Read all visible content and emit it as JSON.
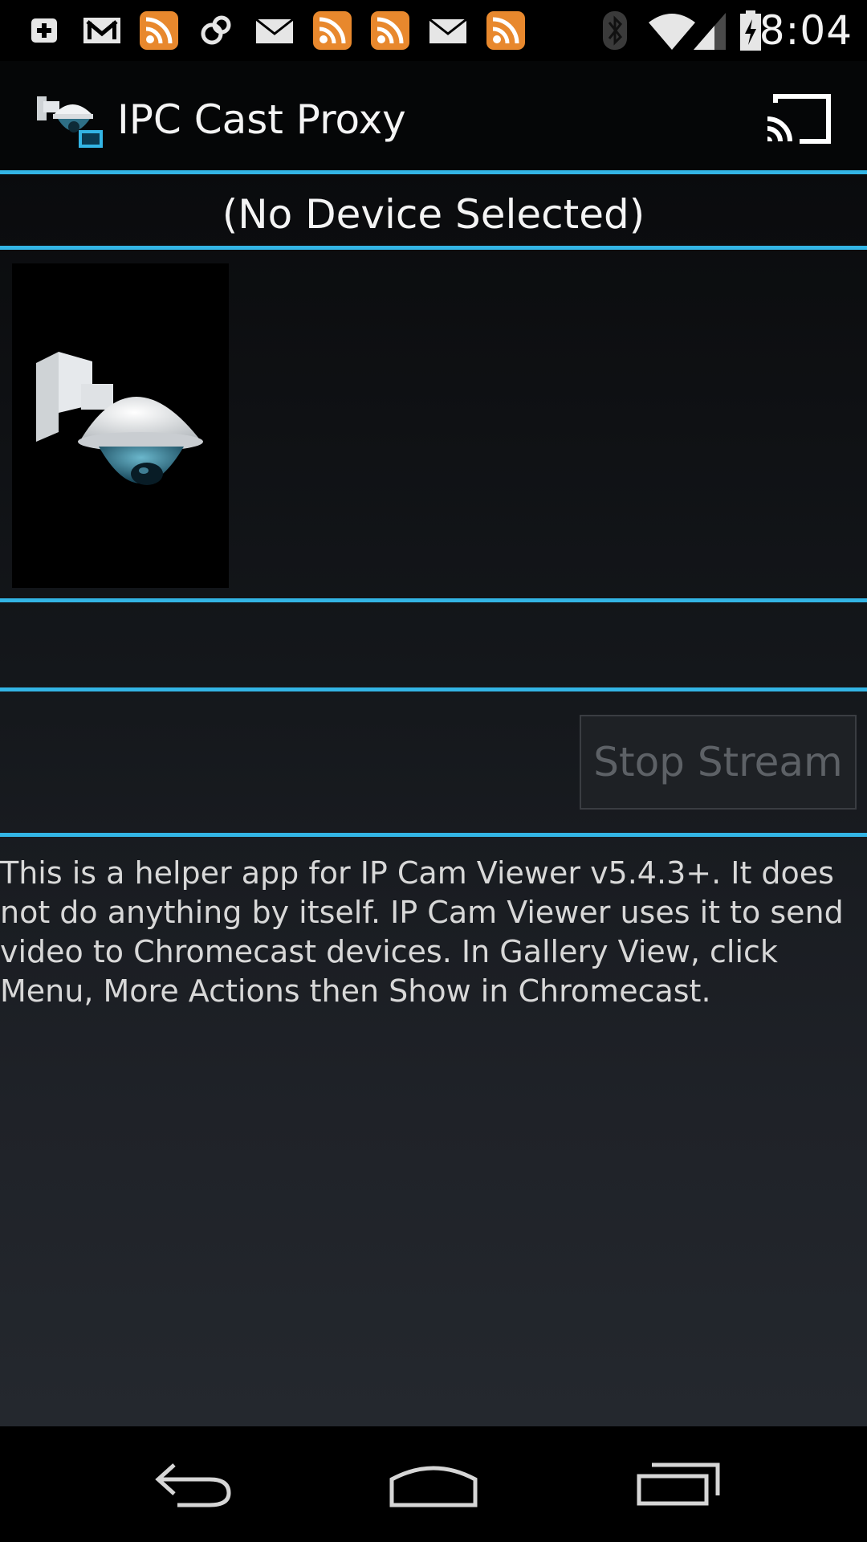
{
  "status_bar": {
    "time": "8:04",
    "left_icons": [
      "add-icon",
      "gmail-icon",
      "rss-icon",
      "sync-icon",
      "mail-icon",
      "rss-icon",
      "rss-icon",
      "mail-icon",
      "rss-icon"
    ],
    "right_icons": [
      "bluetooth-icon",
      "wifi-icon",
      "signal-icon",
      "battery-icon"
    ]
  },
  "action_bar": {
    "title": "IPC Cast Proxy",
    "cast_icon": "cast-icon"
  },
  "device": {
    "label": "(No Device Selected)"
  },
  "controls": {
    "stop_button": "Stop Stream"
  },
  "description": "This is a helper app for IP Cam Viewer v5.4.3+. It does not do anything by itself. IP Cam Viewer uses it to send video to Chromecast devices. In Gallery View, click Menu, More Actions then Show in Chromecast.",
  "nav_bar": [
    "back-icon",
    "home-icon",
    "recents-icon"
  ],
  "colors": {
    "accent": "#33b5e5",
    "rss": "#e8882d",
    "background": "#000000"
  }
}
